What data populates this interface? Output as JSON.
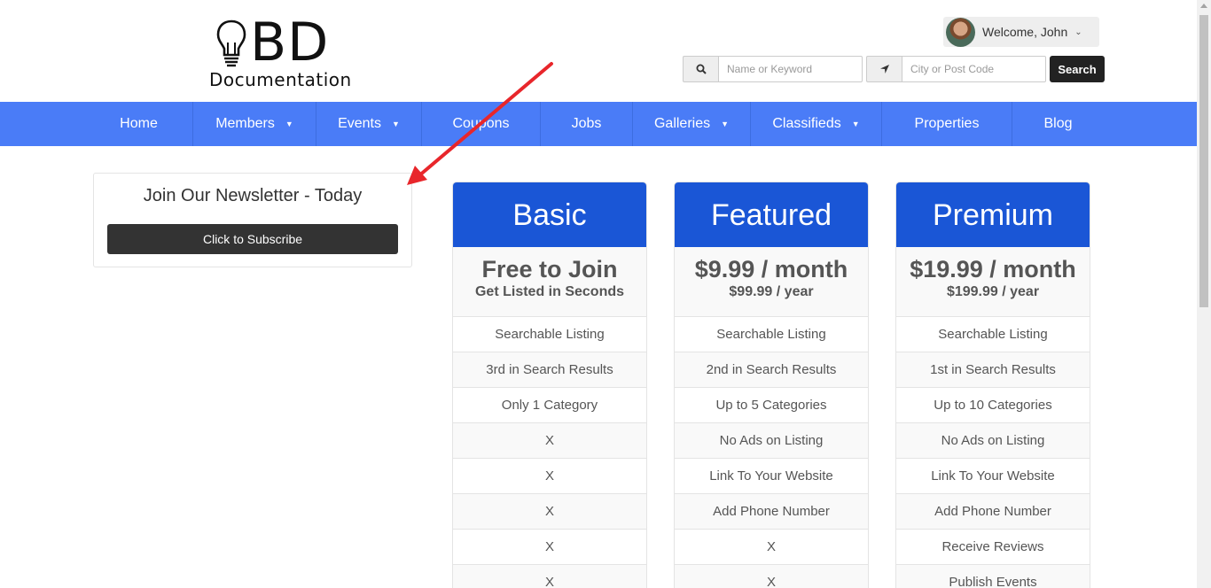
{
  "logo": {
    "bd": "BD",
    "doc": "Documentation"
  },
  "user": {
    "welcome": "Welcome, John"
  },
  "search": {
    "keyword_placeholder": "Name or Keyword",
    "location_placeholder": "City or Post Code",
    "button": "Search"
  },
  "nav": {
    "items": [
      {
        "label": "Home",
        "dropdown": false
      },
      {
        "label": "Members",
        "dropdown": true
      },
      {
        "label": "Events",
        "dropdown": true
      },
      {
        "label": "Coupons",
        "dropdown": false
      },
      {
        "label": "Jobs",
        "dropdown": false
      },
      {
        "label": "Galleries",
        "dropdown": true
      },
      {
        "label": "Classifieds",
        "dropdown": true
      },
      {
        "label": "Properties",
        "dropdown": false
      },
      {
        "label": "Blog",
        "dropdown": false
      }
    ]
  },
  "newsletter": {
    "title": "Join Our Newsletter - Today",
    "button": "Click to Subscribe"
  },
  "plans": [
    {
      "name": "Basic",
      "price": "Free to Join",
      "sub": "Get Listed in Seconds",
      "features": [
        "Searchable Listing",
        "3rd in Search Results",
        "Only 1 Category",
        "X",
        "X",
        "X",
        "X",
        "X"
      ]
    },
    {
      "name": "Featured",
      "price": "$9.99 / month",
      "sub": "$99.99 / year",
      "features": [
        "Searchable Listing",
        "2nd in Search Results",
        "Up to 5 Categories",
        "No Ads on Listing",
        "Link To Your Website",
        "Add Phone Number",
        "X",
        "X"
      ]
    },
    {
      "name": "Premium",
      "price": "$19.99 / month",
      "sub": "$199.99 / year",
      "features": [
        "Searchable Listing",
        "1st in Search Results",
        "Up to 10 Categories",
        "No Ads on Listing",
        "Link To Your Website",
        "Add Phone Number",
        "Receive Reviews",
        "Publish Events"
      ]
    }
  ],
  "colors": {
    "nav": "#4a7cf7",
    "plan_header": "#1a56d6",
    "annotation_arrow": "#e8262b"
  }
}
